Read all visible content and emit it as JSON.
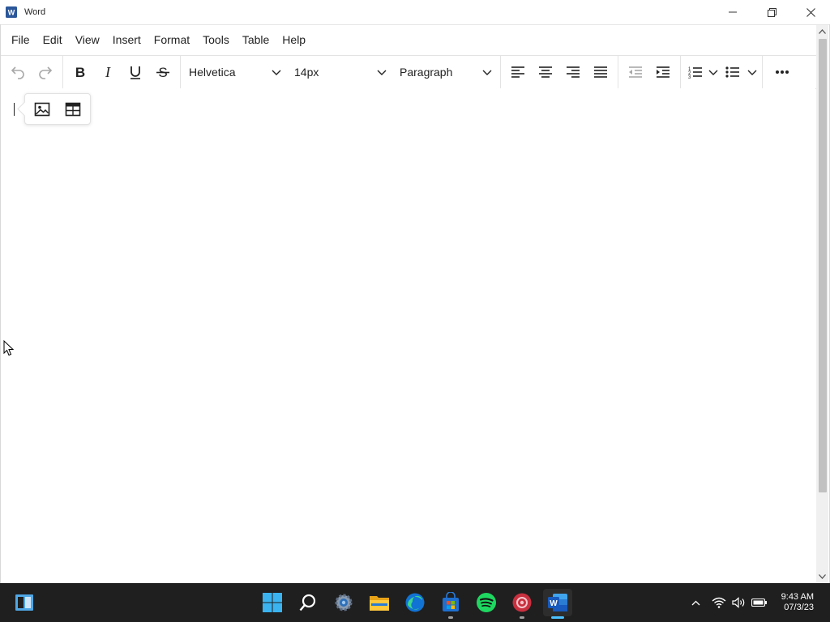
{
  "window": {
    "title": "Word",
    "controls": {
      "minimize": "minimize",
      "restore": "restore",
      "close": "close"
    }
  },
  "menu": {
    "items": [
      "File",
      "Edit",
      "View",
      "Insert",
      "Format",
      "Tools",
      "Table",
      "Help"
    ]
  },
  "toolbar": {
    "font_family": "Helvetica",
    "font_size": "14px",
    "block_format": "Paragraph"
  },
  "quick_insert": {
    "buttons": [
      "image-icon",
      "table-icon"
    ]
  },
  "taskbar": {
    "apps": [
      "start",
      "search",
      "settings",
      "file-explorer",
      "edge",
      "microsoft-store",
      "spotify",
      "app-red",
      "word"
    ],
    "active_app": "word",
    "accent": "#4cc2ff"
  },
  "clock": {
    "time": "9:43 AM",
    "date": "07/3/23"
  }
}
